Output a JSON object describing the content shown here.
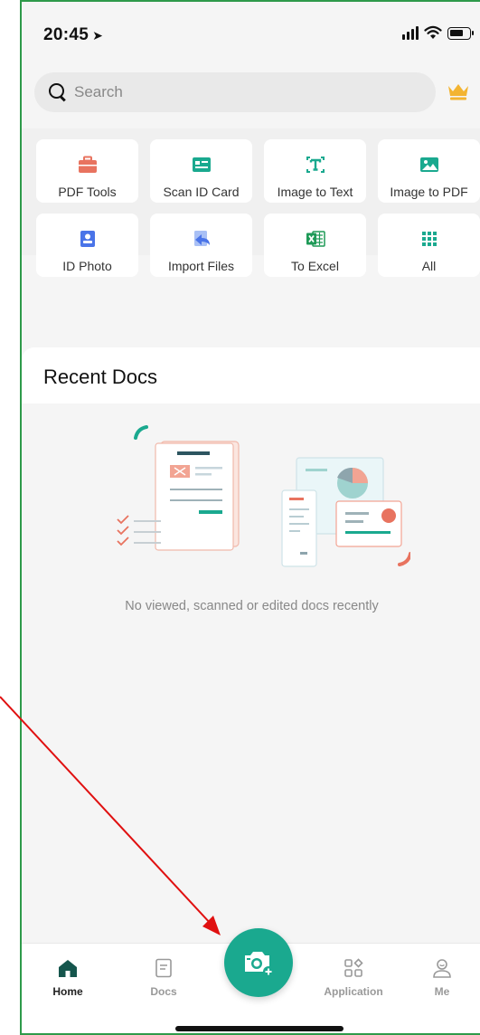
{
  "status_bar": {
    "time": "20:45",
    "location_glyph": "➤"
  },
  "search": {
    "placeholder": "Search"
  },
  "tools": [
    {
      "label": "PDF Tools",
      "icon": "briefcase-icon",
      "color": "#e8735f"
    },
    {
      "label": "Scan ID Card",
      "icon": "id-card-icon",
      "color": "#1aa98f"
    },
    {
      "label": "Image to Text",
      "icon": "text-recognition-icon",
      "color": "#1aa98f"
    },
    {
      "label": "Image to PDF",
      "icon": "image-icon",
      "color": "#1aa98f"
    },
    {
      "label": "ID Photo",
      "icon": "id-photo-icon",
      "color": "#4a74e8"
    },
    {
      "label": "Import Files",
      "icon": "import-icon",
      "color": "#4a74e8"
    },
    {
      "label": "To Excel",
      "icon": "excel-icon",
      "color": "#1e9a57"
    },
    {
      "label": "All",
      "icon": "grid-icon",
      "color": "#1aa98f"
    }
  ],
  "recent": {
    "title": "Recent Docs",
    "empty_message": "No viewed, scanned or edited docs recently"
  },
  "tabbar": {
    "home": "Home",
    "docs": "Docs",
    "application": "Application",
    "me": "Me"
  },
  "colors": {
    "accent": "#1aa98f",
    "coral": "#e8735f",
    "annotation_arrow": "#e01010"
  }
}
